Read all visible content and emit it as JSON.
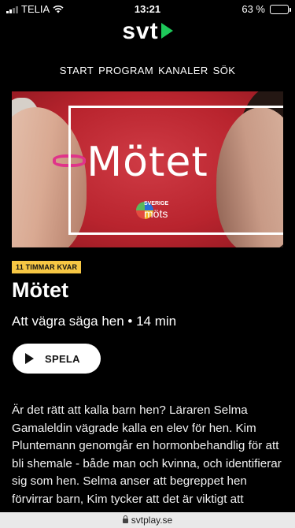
{
  "status_bar": {
    "carrier": "TELIA",
    "time": "13:21",
    "battery_percent": "63 %",
    "battery_level": 0.63
  },
  "logo": {
    "text": "svt"
  },
  "nav": {
    "items": [
      "START",
      "PROGRAM",
      "KANALER",
      "SÖK"
    ]
  },
  "hero": {
    "title": "Mötet",
    "badge_top": "SVERIGE",
    "badge_bottom": "möts"
  },
  "program": {
    "time_left": "11 TIMMAR KVAR",
    "title": "Mötet",
    "subtitle": "Att vägra säga hen • 14 min",
    "play_label": "SPELA",
    "description": "Är det rätt att kalla barn hen? Läraren Selma Gamaleldin vägrade kalla en elev för hen. Kim Pluntemann genomgår en hormonbehandlig för att bli shemale - både man och kvinna, och identifierar sig som hen. Selma anser att begreppet hen förvirrar barn, Kim tycker att det är viktigt att respektera det pronomen som barn önskar. Vad"
  },
  "browser": {
    "url": "svtplay.se"
  },
  "colors": {
    "accent": "#1ec85a",
    "badge": "#f7c744",
    "background": "#000000"
  }
}
